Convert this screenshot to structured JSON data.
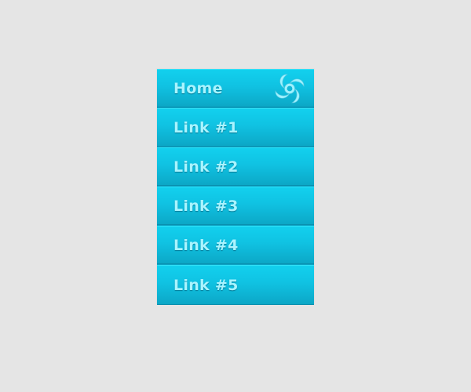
{
  "menu": {
    "items": [
      {
        "label": "Home"
      },
      {
        "label": "Link #1"
      },
      {
        "label": "Link #2"
      },
      {
        "label": "Link #3"
      },
      {
        "label": "Link #4"
      },
      {
        "label": "Link #5"
      }
    ],
    "logo_icon": "swirl-icon"
  },
  "colors": {
    "background": "#e5e5e5",
    "menu_top": "#12d0ee",
    "menu_bottom": "#0ca7c6",
    "label": "#a9f4ff",
    "logo": "#9ff2ff"
  }
}
